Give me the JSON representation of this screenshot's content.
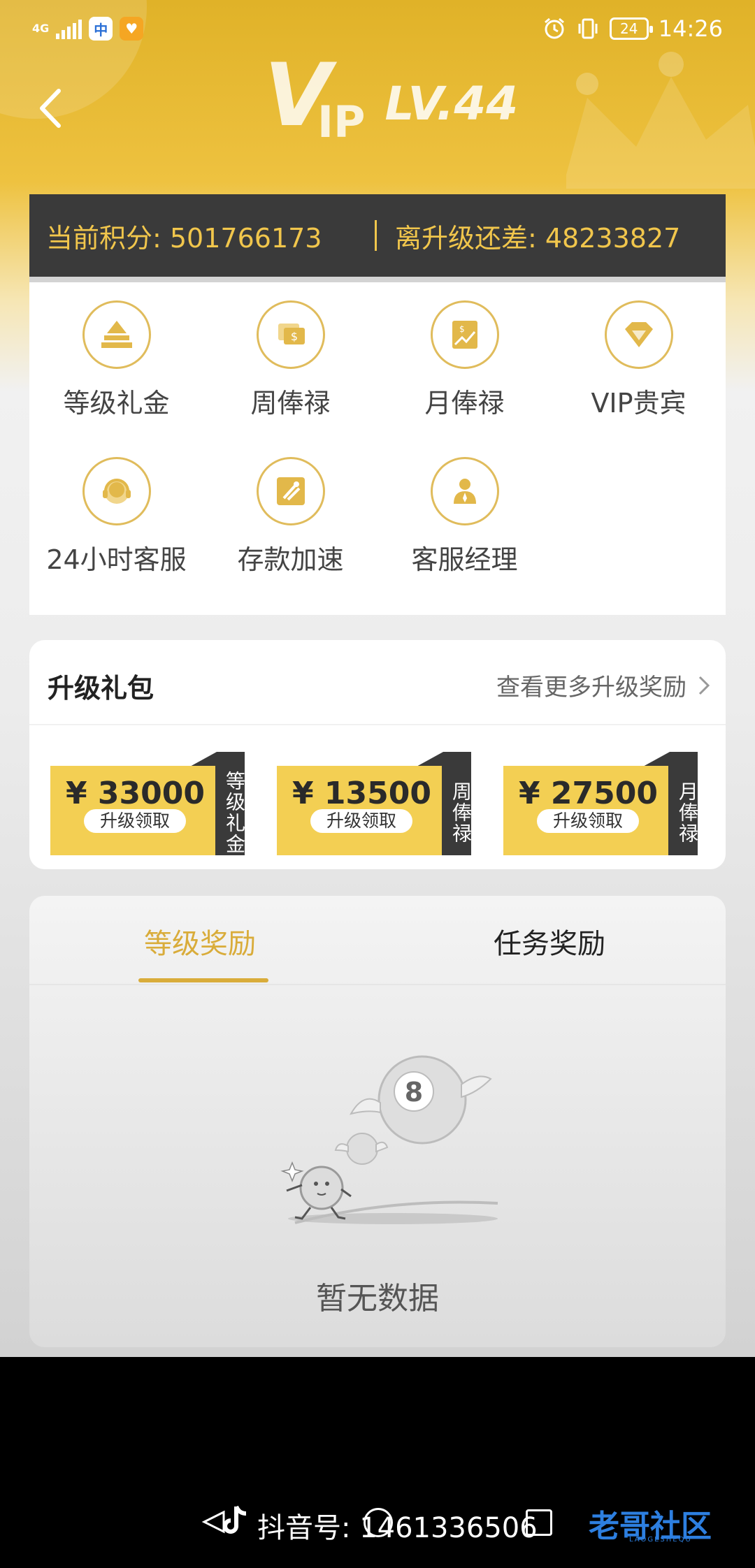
{
  "status_bar": {
    "network": "4G",
    "time": "14:26",
    "battery": "24"
  },
  "header": {
    "vip_v": "V",
    "vip_ip": "IP",
    "level": "LV.44"
  },
  "points": {
    "current": "当前积分: 501766173",
    "remaining": "离升级还差: 48233827"
  },
  "benefits": [
    {
      "label": "等级礼金",
      "icon": "pyramid-icon"
    },
    {
      "label": "周俸禄",
      "icon": "money-bag-icon"
    },
    {
      "label": "月俸禄",
      "icon": "chart-card-icon"
    },
    {
      "label": "VIP贵宾",
      "icon": "diamond-icon"
    },
    {
      "label": "24小时客服",
      "icon": "headset-icon"
    },
    {
      "label": "存款加速",
      "icon": "rocket-icon"
    },
    {
      "label": "客服经理",
      "icon": "manager-icon"
    }
  ],
  "upgrade": {
    "title": "升级礼包",
    "more": "查看更多升级奖励",
    "coupons": [
      {
        "amount": "¥ 33000",
        "action": "升级领取",
        "tag": "等级礼金"
      },
      {
        "amount": "¥ 13500",
        "action": "升级领取",
        "tag": "周俸禄"
      },
      {
        "amount": "¥ 27500",
        "action": "升级领取",
        "tag": "月俸禄"
      }
    ]
  },
  "rewards": {
    "tabs": [
      "等级奖励",
      "任务奖励"
    ],
    "active_tab": "等级奖励",
    "empty_text": "暂无数据"
  },
  "watermark": {
    "text": "抖音号: 1461336506",
    "logo": "老哥社区",
    "logo_sub": "LAOGESHEQU"
  },
  "colors": {
    "gold": "#e0b228",
    "accent": "#d9ac3a",
    "points_text": "#f1c64c",
    "dark_bar": "#3a3a3a",
    "coupon_yellow": "#f3cf53"
  }
}
